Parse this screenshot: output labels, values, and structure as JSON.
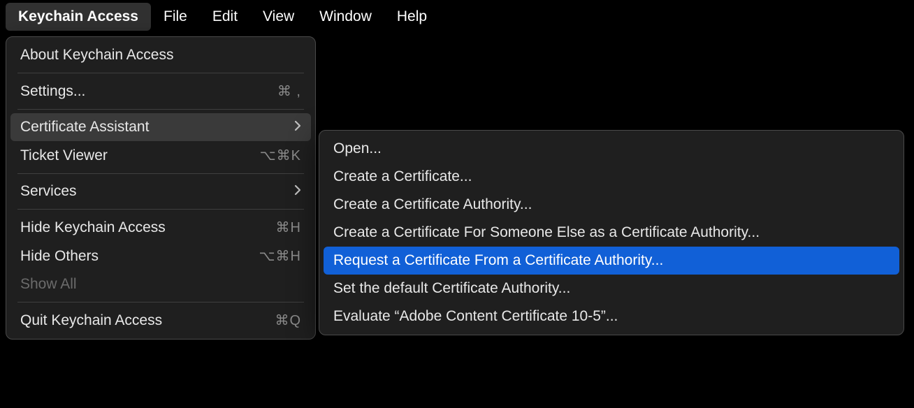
{
  "menubar": {
    "items": [
      {
        "label": "Keychain Access",
        "active": true
      },
      {
        "label": "File"
      },
      {
        "label": "Edit"
      },
      {
        "label": "View"
      },
      {
        "label": "Window"
      },
      {
        "label": "Help"
      }
    ]
  },
  "main_menu": {
    "about": "About Keychain Access",
    "settings": {
      "label": "Settings...",
      "shortcut": "⌘ ,"
    },
    "cert_assistant": "Certificate Assistant",
    "ticket_viewer": {
      "label": "Ticket Viewer",
      "shortcut": "⌥⌘K"
    },
    "services": "Services",
    "hide": {
      "label": "Hide Keychain Access",
      "shortcut": "⌘H"
    },
    "hide_others": {
      "label": "Hide Others",
      "shortcut": "⌥⌘H"
    },
    "show_all": "Show All",
    "quit": {
      "label": "Quit Keychain Access",
      "shortcut": "⌘Q"
    }
  },
  "submenu": {
    "open": "Open...",
    "create_cert": "Create a Certificate...",
    "create_ca": "Create a Certificate Authority...",
    "create_for_else": "Create a Certificate For Someone Else as a Certificate Authority...",
    "request": "Request a Certificate From a Certificate Authority...",
    "set_default": "Set the default Certificate Authority...",
    "evaluate": "Evaluate “Adobe Content Certificate 10-5”..."
  }
}
